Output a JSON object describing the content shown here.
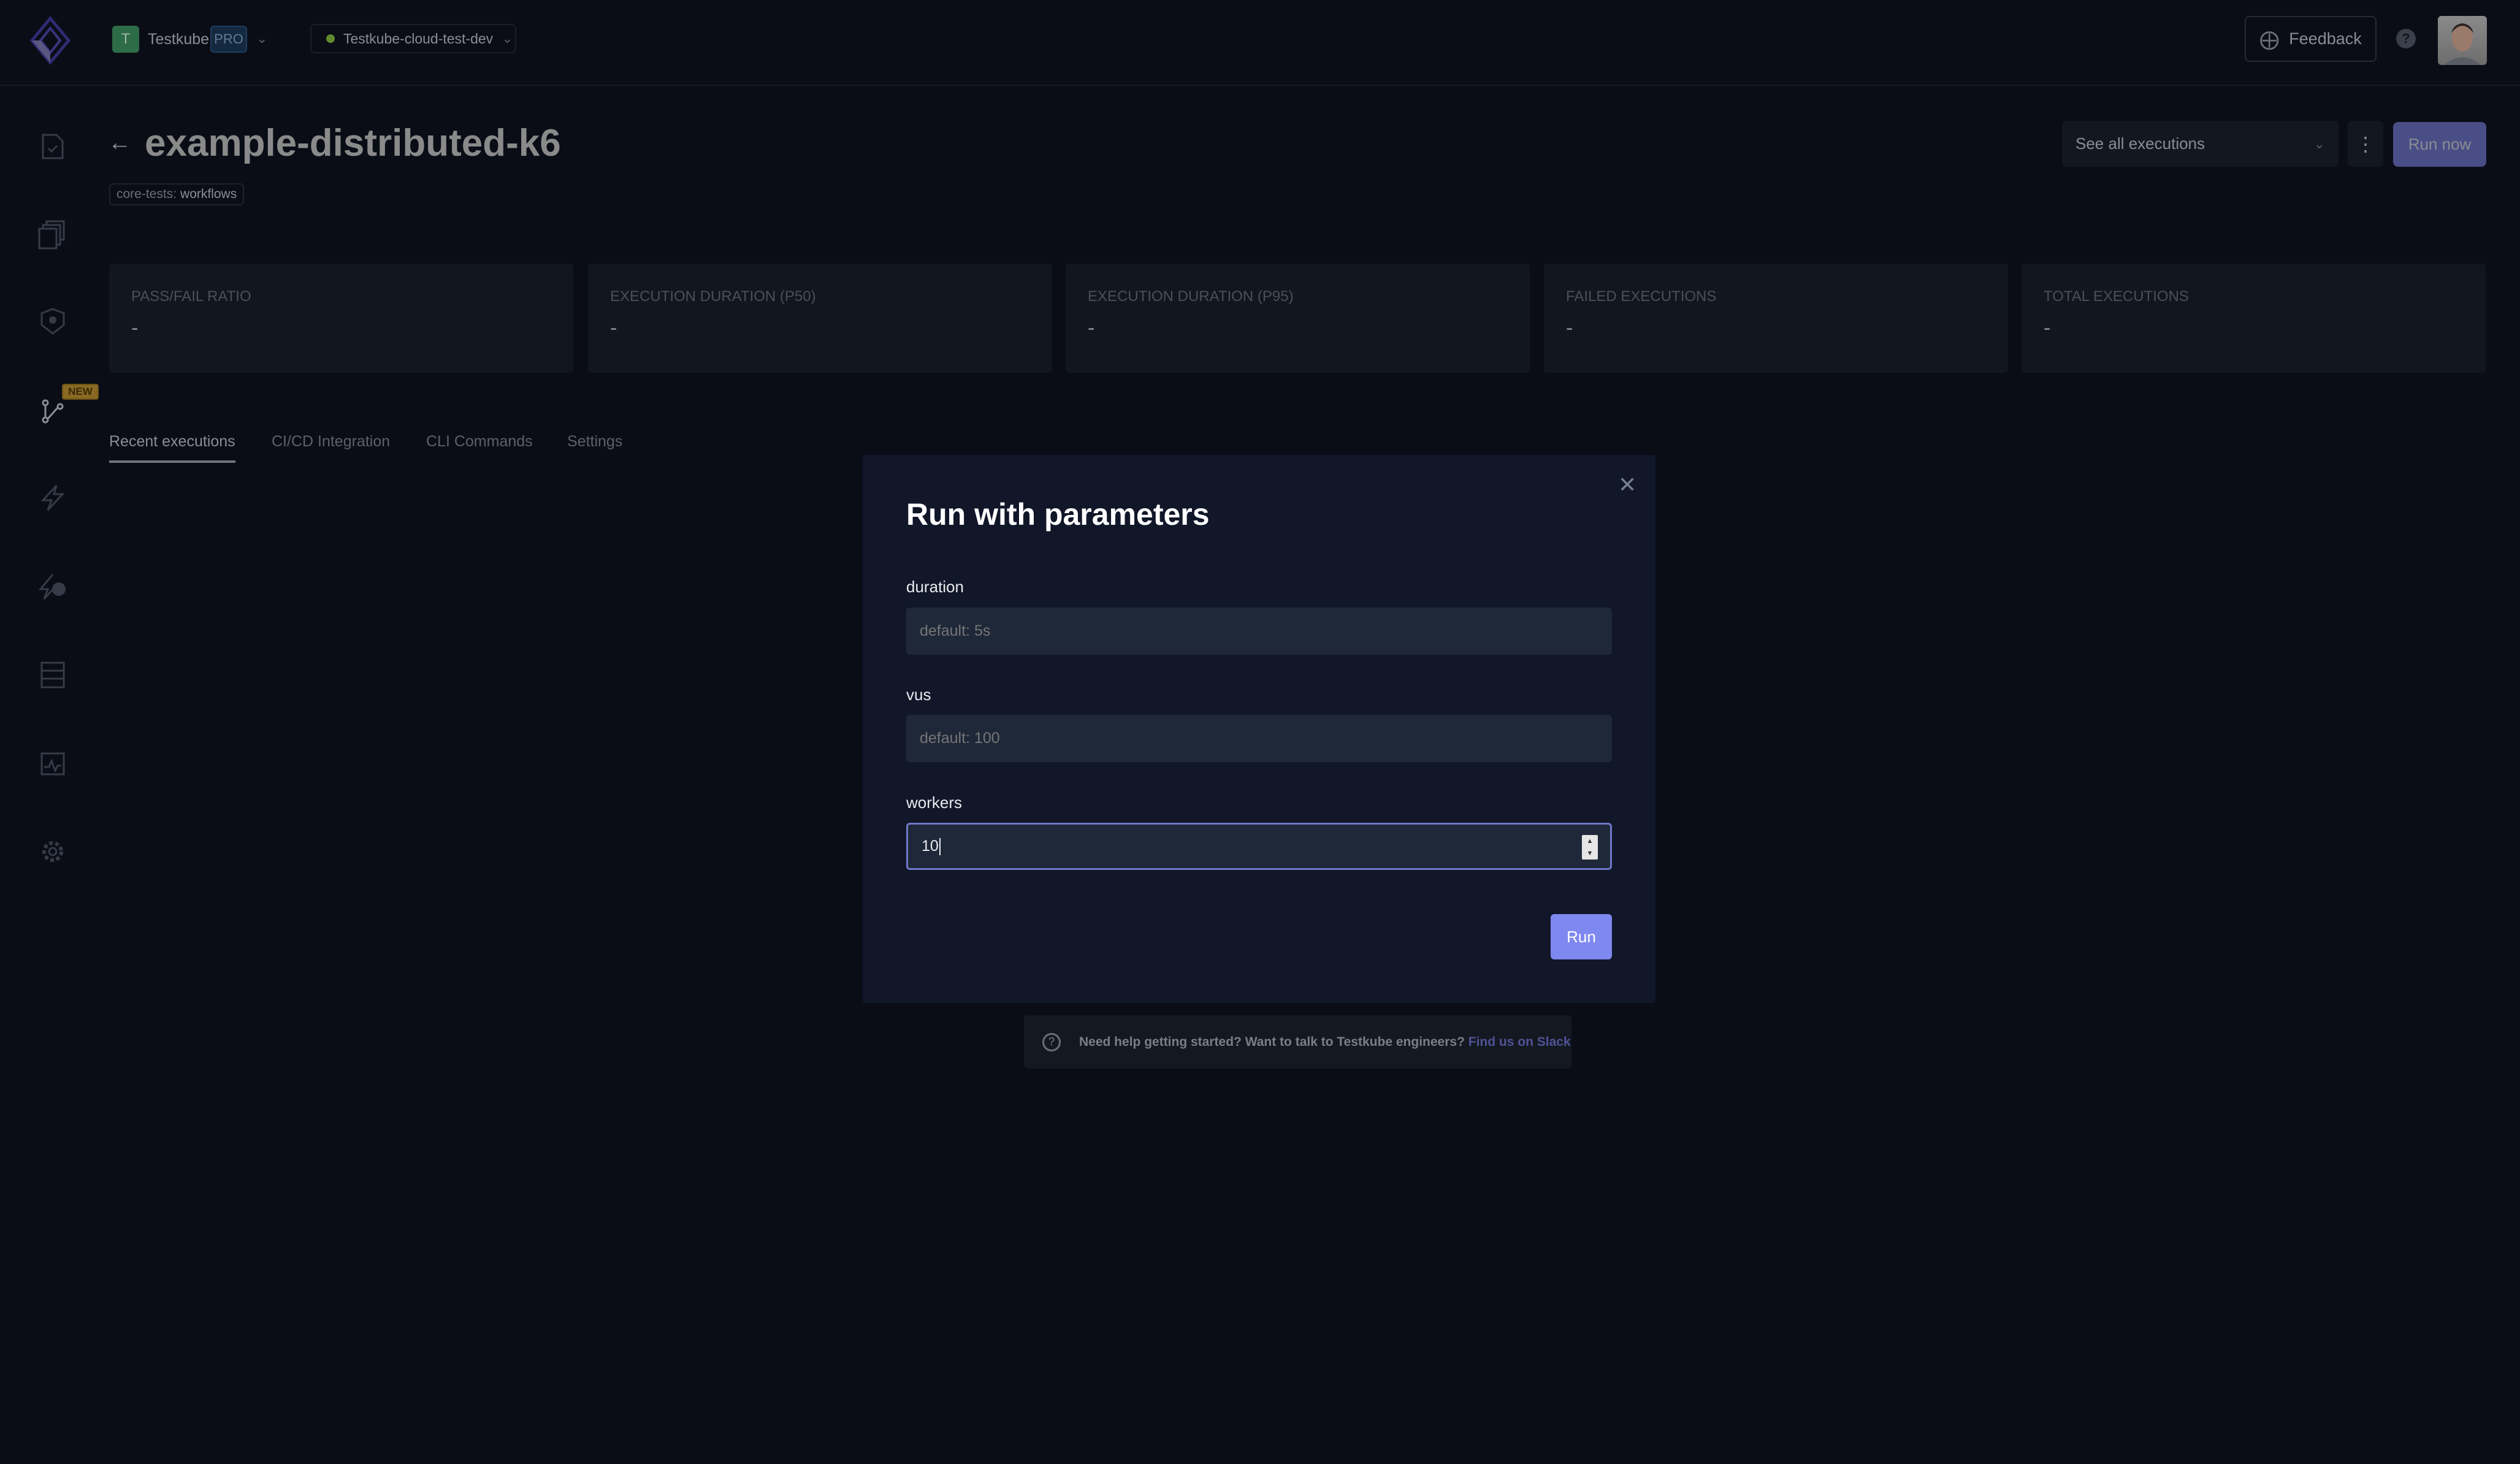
{
  "header": {
    "org_initial": "T",
    "org_name": "Testkube",
    "plan_badge": "PRO",
    "environment": "Testkube-cloud-test-dev",
    "environment_status_color": "#5f8a2e",
    "feedback_label": "Feedback",
    "help_icon": "question-circle-icon"
  },
  "sidebar": {
    "items": [
      {
        "icon": "test-file-icon"
      },
      {
        "icon": "test-suites-icon"
      },
      {
        "icon": "shield-gear-icon"
      },
      {
        "icon": "workflow-branch-icon",
        "badge": "NEW"
      },
      {
        "icon": "trigger-bolt-icon"
      },
      {
        "icon": "webhook-bolt-icon"
      },
      {
        "icon": "sources-server-icon"
      },
      {
        "icon": "executors-clipboard-icon"
      },
      {
        "icon": "settings-gear-icon"
      }
    ]
  },
  "page": {
    "title": "example-distributed-k6",
    "tag_key": "core-tests:",
    "tag_value": "workflows",
    "executions_select": "See all executions",
    "run_now_label": "Run now",
    "accent_color": "#7f88f0"
  },
  "stats": [
    {
      "label": "PASS/FAIL RATIO",
      "value": "-"
    },
    {
      "label": "EXECUTION DURATION (P50)",
      "value": "-"
    },
    {
      "label": "EXECUTION DURATION (P95)",
      "value": "-"
    },
    {
      "label": "FAILED EXECUTIONS",
      "value": "-"
    },
    {
      "label": "TOTAL EXECUTIONS",
      "value": "-"
    }
  ],
  "tabs": [
    {
      "label": "Recent executions",
      "active": true
    },
    {
      "label": "CI/CD Integration"
    },
    {
      "label": "CLI Commands"
    },
    {
      "label": "Settings"
    }
  ],
  "modal": {
    "title": "Run with parameters",
    "fields": [
      {
        "label": "duration",
        "placeholder": "default: 5s",
        "value": ""
      },
      {
        "label": "vus",
        "placeholder": "default: 100",
        "value": ""
      },
      {
        "label": "workers",
        "placeholder": "",
        "value": "10"
      }
    ],
    "run_label": "Run"
  },
  "help_banner": {
    "text": "Need help getting started? Want to talk to Testkube engineers?",
    "link": "Find us on Slack"
  }
}
